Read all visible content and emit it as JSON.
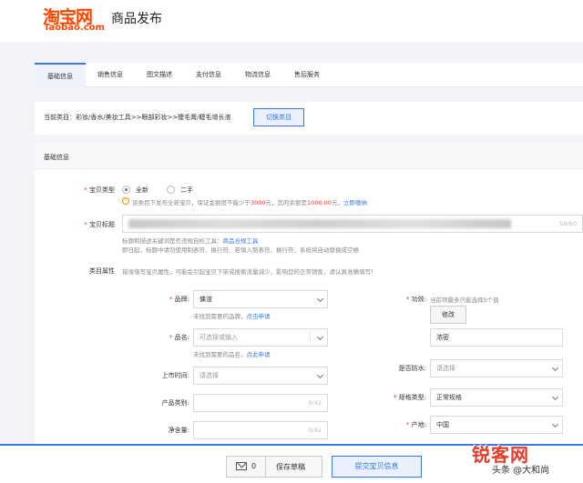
{
  "header": {
    "logo_cn": "淘宝网",
    "logo_en": "Taobao.com",
    "title": "商品发布"
  },
  "tabs": [
    {
      "label": "基础信息",
      "active": true
    },
    {
      "label": "销售信息"
    },
    {
      "label": "图文描述"
    },
    {
      "label": "支付信息"
    },
    {
      "label": "物流信息"
    },
    {
      "label": "售后服务"
    }
  ],
  "category": {
    "text": "当前类目：彩妆/香水/美妆工具>>眼部彩妆>>睫毛膏/睫毛增长液",
    "switch_label": "切换类目"
  },
  "basic": {
    "section_title": "基础信息",
    "type_label": "宝贝类型",
    "type_new": "全新",
    "type_used": "二手",
    "type_tip_pre": "该类目下发布全新宝贝，保证金额度不能少于",
    "type_tip_amt1": "3000",
    "type_tip_mid": "元，您的余额是",
    "type_tip_amt2": "1000.00",
    "type_tip_post": "元，",
    "type_tip_link": "立即缴纳",
    "title_label": "宝贝标题",
    "title_count": "59/60",
    "title_hint1_pre": "标题和描述关键词是否违规自检工具：",
    "title_hint1_link": "商品合规工具",
    "title_hint2": "即日起，标题中请勿使用制表符、换行符、若填入制表符、换行符，系统将自动替换成空格",
    "attr_label": "类目属性",
    "attr_tip": "错误填写宝贝属性，可能会引起宝贝下架或搜索流量减少，影响您的正常销售，请认真准确填写！"
  },
  "attrs_left": {
    "brand_label": "品牌:",
    "brand_value": "傭渲",
    "brand_hint_pre": "未找到需要的品牌，",
    "brand_hint_link": "点击申请",
    "name_label": "品名:",
    "name_placeholder": "可选择或输入",
    "name_hint_pre": "未找到需要的品名，",
    "name_hint_link": "点此申请",
    "date_label": "上市时间:",
    "date_placeholder": "请选择",
    "category_label": "产品类别:",
    "category_count": "0/42",
    "volume_label": "净含量:",
    "volume_count": "0/42"
  },
  "attrs_right": {
    "effect_label": "功效:",
    "effect_tip": "当前项最多只能选择5个值",
    "effect_edit": "修改",
    "effect_value": "浓密",
    "waterproof_label": "是否防水:",
    "waterproof_placeholder": "请选择",
    "spec_label": "规格类型:",
    "spec_value": "正常规格",
    "origin_label": "产地:",
    "origin_value": "中国"
  },
  "footer": {
    "draft_count": "0",
    "draft_label": "保存草稿",
    "submit_label": "提交宝贝信息"
  },
  "watermark": {
    "main": "锐客网",
    "sub": "头条 @大和尚"
  },
  "colors": {
    "brand": "#ff4400",
    "accent": "#3b78e7",
    "required": "#e4393c"
  }
}
